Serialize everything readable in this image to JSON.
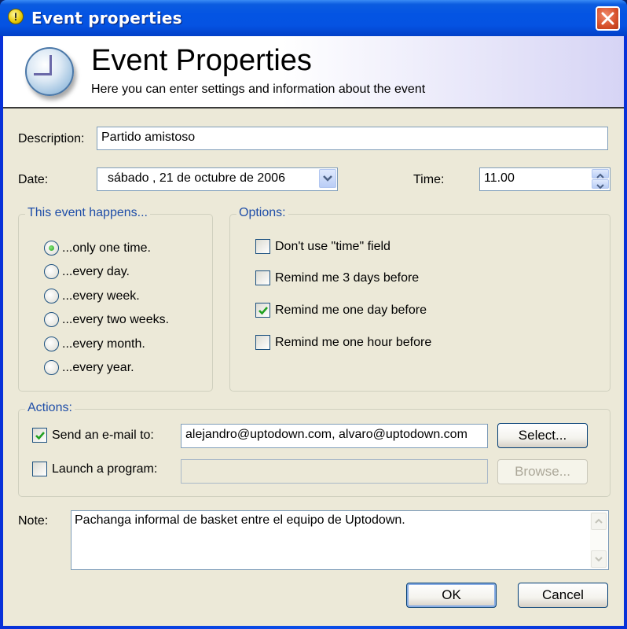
{
  "window": {
    "title": "Event properties",
    "title_icon": "warning-exclamation-icon",
    "close_icon": "close-icon"
  },
  "banner": {
    "icon": "clock-icon",
    "title": "Event Properties",
    "subtitle": "Here you can enter settings and information about the event"
  },
  "form": {
    "description_label": "Description:",
    "description_value": "Partido amistoso",
    "date_label": "Date:",
    "date_value": "sábado  , 21 de   octubre   de 2006",
    "time_label": "Time:",
    "time_value": "11.00"
  },
  "recurrence": {
    "legend": "This event happens...",
    "options": [
      {
        "label": "...only one time.",
        "selected": true
      },
      {
        "label": "...every day.",
        "selected": false
      },
      {
        "label": "...every week.",
        "selected": false
      },
      {
        "label": "...every two weeks.",
        "selected": false
      },
      {
        "label": "...every month.",
        "selected": false
      },
      {
        "label": "...every year.",
        "selected": false
      }
    ]
  },
  "options": {
    "legend": "Options:",
    "items": [
      {
        "label": "Don't use \"time\" field",
        "checked": false
      },
      {
        "label": "Remind me 3 days before",
        "checked": false
      },
      {
        "label": "Remind me one day before",
        "checked": true
      },
      {
        "label": "Remind me one hour before",
        "checked": false
      }
    ]
  },
  "actions": {
    "legend": "Actions:",
    "email_label": "Send an e-mail to:",
    "email_checked": true,
    "email_value": "alejandro@uptodown.com, alvaro@uptodown.com",
    "select_button": "Select...",
    "program_label": "Launch a program:",
    "program_checked": false,
    "program_value": "",
    "browse_button": "Browse..."
  },
  "note": {
    "label": "Note:",
    "value": "Pachanga informal de basket entre el equipo de Uptodown."
  },
  "buttons": {
    "ok": "OK",
    "cancel": "Cancel"
  }
}
